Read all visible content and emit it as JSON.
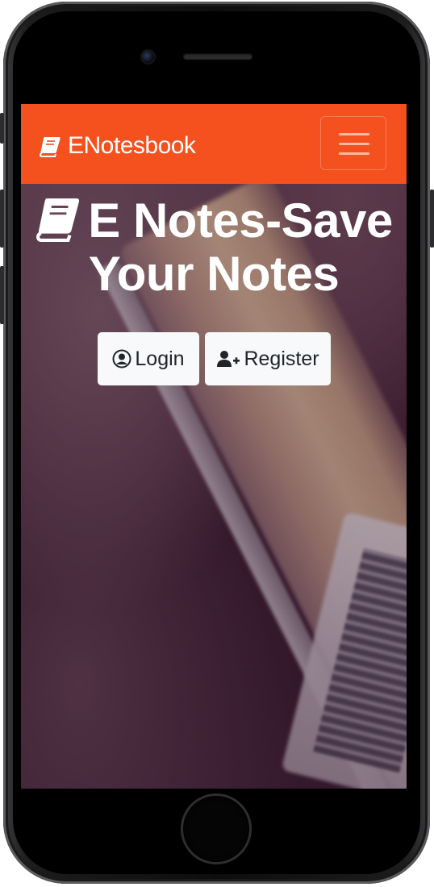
{
  "navbar": {
    "brand": "ENotesbook",
    "brand_icon": "book-icon",
    "toggler_icon": "hamburger-menu-icon",
    "background_color": "#f4511e"
  },
  "hero": {
    "title_line1": "E Notes-Save",
    "title_line2": "Your Notes",
    "title_icon": "book-icon"
  },
  "actions": {
    "login_label": "Login",
    "login_icon": "user-circle-icon",
    "register_label": "Register",
    "register_icon": "user-plus-icon"
  }
}
